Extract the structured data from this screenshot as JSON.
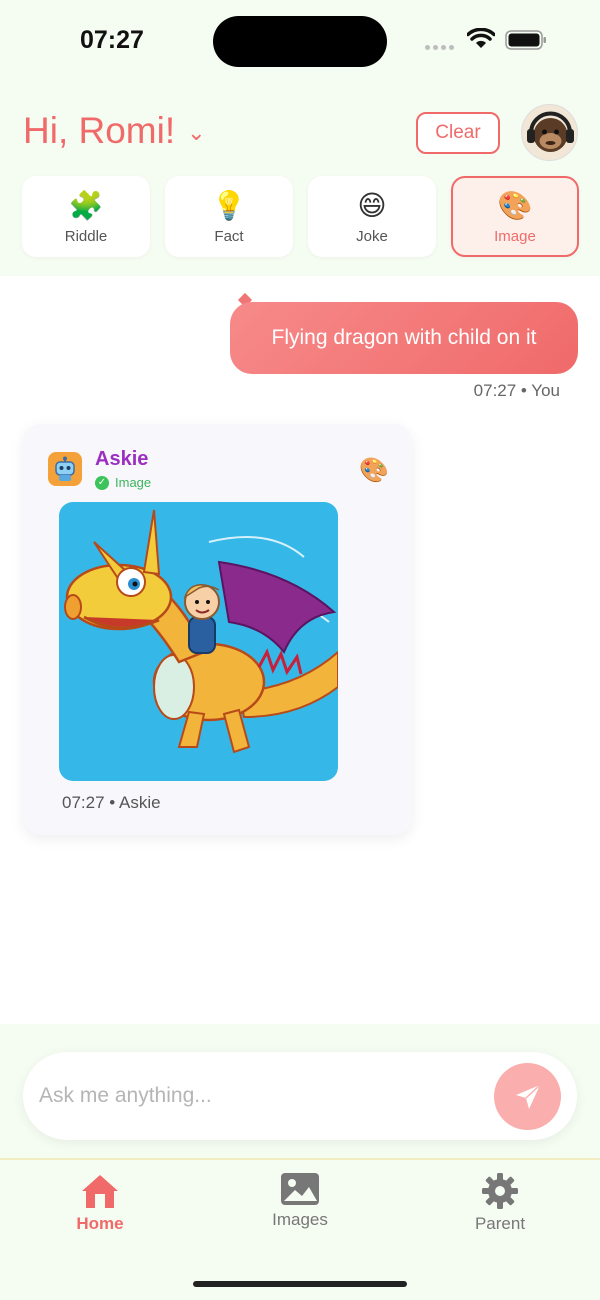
{
  "status_bar": {
    "time": "07:27"
  },
  "header": {
    "greeting": "Hi, Romi!",
    "clear_label": "Clear"
  },
  "categories": [
    {
      "label": "Riddle",
      "icon": "puzzle-icon",
      "glyph": "🧩",
      "active": false
    },
    {
      "label": "Fact",
      "icon": "lightbulb-icon",
      "glyph": "💡",
      "active": false
    },
    {
      "label": "Joke",
      "icon": "smile-icon",
      "glyph": "😄",
      "active": false
    },
    {
      "label": "Image",
      "icon": "palette-icon",
      "glyph": "🎨",
      "active": true
    }
  ],
  "chat": {
    "user_message": {
      "text": "Flying dragon with child on it",
      "meta": "07:27 • You"
    },
    "bot_message": {
      "name": "Askie",
      "badge": "Image",
      "meta": "07:27 • Askie"
    }
  },
  "input": {
    "placeholder": "Ask me anything..."
  },
  "nav": [
    {
      "label": "Home",
      "icon": "home-icon",
      "active": true
    },
    {
      "label": "Images",
      "icon": "image-icon",
      "active": false
    },
    {
      "label": "Parent",
      "icon": "gear-icon",
      "active": false
    }
  ],
  "colors": {
    "accent": "#f06a6a",
    "bot_name": "#9b2fc1",
    "badge_green": "#3cb45c",
    "background_tint": "#f5fcf2"
  }
}
